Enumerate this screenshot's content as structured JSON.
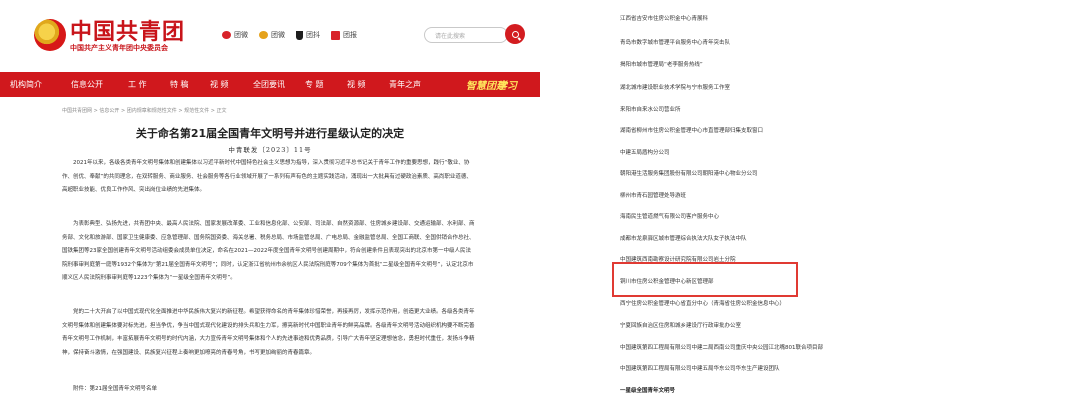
{
  "header": {
    "site_title": "中国共青团",
    "site_subtitle": "中国共产主义青年团中央委员会",
    "links": [
      {
        "icon": "weibo-icon",
        "label": "团微"
      },
      {
        "icon": "wechat-icon",
        "label": "团微"
      },
      {
        "icon": "douyin-icon",
        "label": "团抖"
      },
      {
        "icon": "news-icon",
        "label": "团报"
      }
    ],
    "search_placeholder": "请在此搜索"
  },
  "nav": {
    "items": [
      "机构简介",
      "信息公开",
      "工 作",
      "特 稿",
      "视 频",
      "全团要讯",
      "专 题",
      "视 频",
      "青年之声"
    ],
    "brand_a": "智慧团建",
    "brand_b": "学习"
  },
  "breadcrumb": "中国共青团网 > 信息公开 > 团内规章和规范性文件 > 规范性文件 > 正文",
  "article": {
    "title": "关于命名第21届全国青年文明号并进行星级认定的决定",
    "doc_number": "中青联发〔2023〕11号",
    "paragraphs": [
      "2021年以来，各级各类青年文明号集体和创建集体以习近平新时代中国特色社会主义思想为指导，深入贯彻习近平总书记关于青年工作的重要思想，践行“敬业、协作、创优、奉献”的共同理念，在双转服务、商业服务、社会服务等各行业领域开展了一系列有声有色的主题实践活动，涌现出一大批具有过硬政治素质、高尚职业道德、高超职业技能、优良工作作风、突出岗位业绩的先进集体。",
      "为表彰典型、弘扬先进，共青团中央、最高人民法院、国家发展改革委、工业和信息化部、公安部、司法部、自然资源部、住房城乡建设部、交通运输部、水利部、商务部、文化和旅游部、国家卫生健康委、应急管理部、国务院国资委、海关总署、税务总局、市场监管总局、广电总局、金融监管总局、全国工商联、全国供销合作总社、国铁集团等23家全国创建青年文明号活动组委会成员单位决定，命名在2021—2022年度全国青年文明号创建周期中，符合创建条件且表现突出的北京市第一中级人民法院刑事审判庭第一庭等1932个集体为“第21届全国青年文明号”；同时，认定浙江省杭州市余杭区人民法院刑庭等709个集体为首批“二星级全国青年文明号”，认定北京市顺义区人民法院刑事审判庭等1223个集体为“一星级全国青年文明号”。",
      "党的二十大开启了以中国式现代化全面推进中华民族伟大复兴的新征程。希望获得命名的青年集体珍惜荣誉，再接再厉，发挥示范作用，创造更大业绩。各级各类青年文明号集体和创建集体要对标先进，担当争优，争当中国式现代化建设的排头兵和生力军，擦亮新时代中国职业青年的鲜亮品牌。各级青年文明号活动组织机构要不断完善青年文明号工作机制，丰富拓展青年文明号的时代内涵，大力宣传青年文明号集体和个人的先进事迹和优秀品质，引导广大青年坚定理想信念，勇担时代重任，发扬斗争精神，保持奋斗激情，在强国建设、民族复兴征程上奏响更加嘹亮的青春号角，书写更加绚丽的青春篇章。"
    ],
    "annex": "附件：第21届全国青年文明号名单"
  },
  "right_list": {
    "items": [
      "江西省吉安市住房公积金中心青展科",
      "青岛市数字城市管理平台服务中心青年突击队",
      "揭阳市城市管理局“老李服务热线”",
      "湖北城市建设职业技术学院与宁市服务工作室",
      "来阳市自来水公司营业所",
      "湖南省柳州市住房公积金管理中心市直管理部归集支取窗口",
      "中建五局盾构分公司",
      "朝阳港生活服务集团股份有限公司朝阳港中心物业分公司",
      "柳州市青石园管理处导游班",
      "海南民生管道燃气有限公司客户服务中心",
      "成都市龙泉驿区城市管理综合执法大队女子执法中队",
      "中国建筑西南勘察设计研究院有限公司岩土分院",
      "铜川市住房公积金管理中心新区管理部",
      "西宁住房公积金管理中心省直分中心（青海省住房公积金信息中心）",
      "宁夏回族自治区住房和城乡建设厅行政审批办公室",
      "中国建筑第四工程局有限公司中建二局西南公司重庆中央公园江北嘴801联合项目部",
      "中国建筑第四工程局有限公司中建五局华东公司华东生产建设团队",
      "一星级全国青年文明号"
    ]
  }
}
